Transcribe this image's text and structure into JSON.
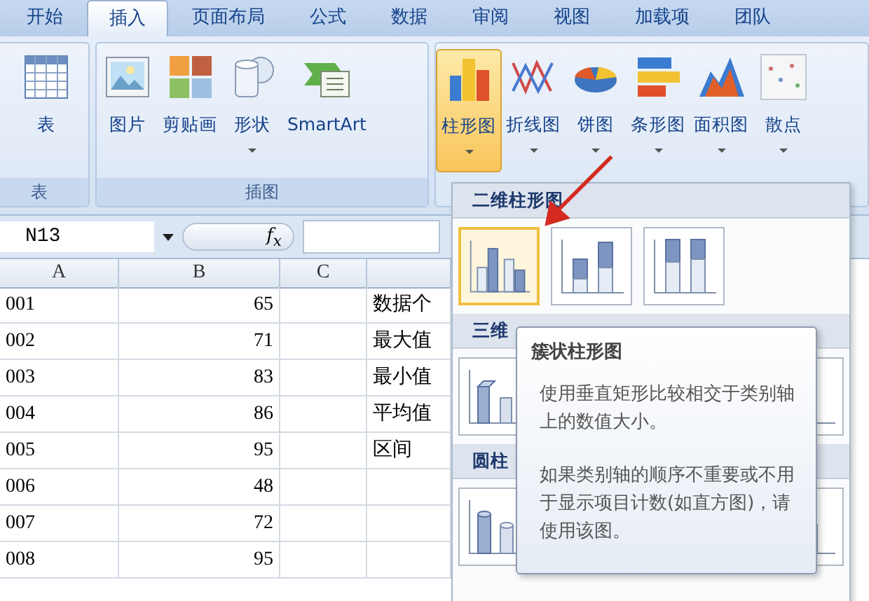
{
  "tabs": [
    {
      "label": "开始",
      "selected": false
    },
    {
      "label": "插入",
      "selected": true
    },
    {
      "label": "页面布局",
      "selected": false
    },
    {
      "label": "公式",
      "selected": false
    },
    {
      "label": "数据",
      "selected": false
    },
    {
      "label": "审阅",
      "selected": false
    },
    {
      "label": "视图",
      "selected": false
    },
    {
      "label": "加载项",
      "selected": false
    },
    {
      "label": "团队",
      "selected": false
    }
  ],
  "ribbon_groups": [
    {
      "label": "表",
      "buttons": [
        {
          "kind": "table",
          "label": "表",
          "dropdown": false,
          "selected": false
        }
      ]
    },
    {
      "label": "插图",
      "buttons": [
        {
          "kind": "picture",
          "label": "图片",
          "dropdown": false,
          "selected": false
        },
        {
          "kind": "clipart",
          "label": "剪贴画",
          "dropdown": false,
          "selected": false
        },
        {
          "kind": "shapes",
          "label": "形状",
          "dropdown": true,
          "selected": false
        },
        {
          "kind": "smartart",
          "label": "SmartArt",
          "dropdown": false,
          "selected": false
        }
      ]
    },
    {
      "buttons": [
        {
          "kind": "column",
          "label": "柱形图",
          "dropdown": true,
          "selected": true
        },
        {
          "kind": "line",
          "label": "折线图",
          "dropdown": true,
          "selected": false
        },
        {
          "kind": "pie",
          "label": "饼图",
          "dropdown": true,
          "selected": false
        },
        {
          "kind": "bar",
          "label": "条形图",
          "dropdown": true,
          "selected": false
        },
        {
          "kind": "area",
          "label": "面积图",
          "dropdown": true,
          "selected": false
        },
        {
          "kind": "scatter",
          "label": "散点",
          "dropdown": true,
          "selected": false
        }
      ]
    }
  ],
  "name_box": "N13",
  "formula_label": "f$_{x}$",
  "columns": [
    "A",
    "B",
    "C"
  ],
  "rows": [
    {
      "a": "001",
      "b": "65",
      "d": "数据个"
    },
    {
      "a": "002",
      "b": "71",
      "d": "最大值"
    },
    {
      "a": "003",
      "b": "83",
      "d": "最小值"
    },
    {
      "a": "004",
      "b": "86",
      "d": "平均值"
    },
    {
      "a": "005",
      "b": "95",
      "d": "区间"
    },
    {
      "a": "006",
      "b": "48"
    },
    {
      "a": "007",
      "b": "72"
    },
    {
      "a": "008",
      "b": "95"
    }
  ],
  "gallery": [
    {
      "title": "二维柱形图",
      "items": [
        {
          "kind": "clustered",
          "selected": true
        },
        {
          "kind": "stacked",
          "selected": false
        },
        {
          "kind": "stacked100",
          "selected": false
        }
      ]
    },
    {
      "title": "三维",
      "items": [
        {
          "kind": "box3d",
          "selected": false
        },
        {
          "kind": "box3d",
          "selected": false
        }
      ]
    },
    {
      "title": "圆柱",
      "items": [
        {
          "kind": "cylinder",
          "selected": false
        },
        {
          "kind": "cylinder",
          "selected": false
        }
      ]
    }
  ],
  "tooltip": {
    "title": "簇状柱形图",
    "paragraphs": [
      "使用垂直矩形比较相交于类别轴上的数值大小。",
      "如果类别轴的顺序不重要或不用于显示项目计数(如直方图)，请使用该图。"
    ]
  }
}
